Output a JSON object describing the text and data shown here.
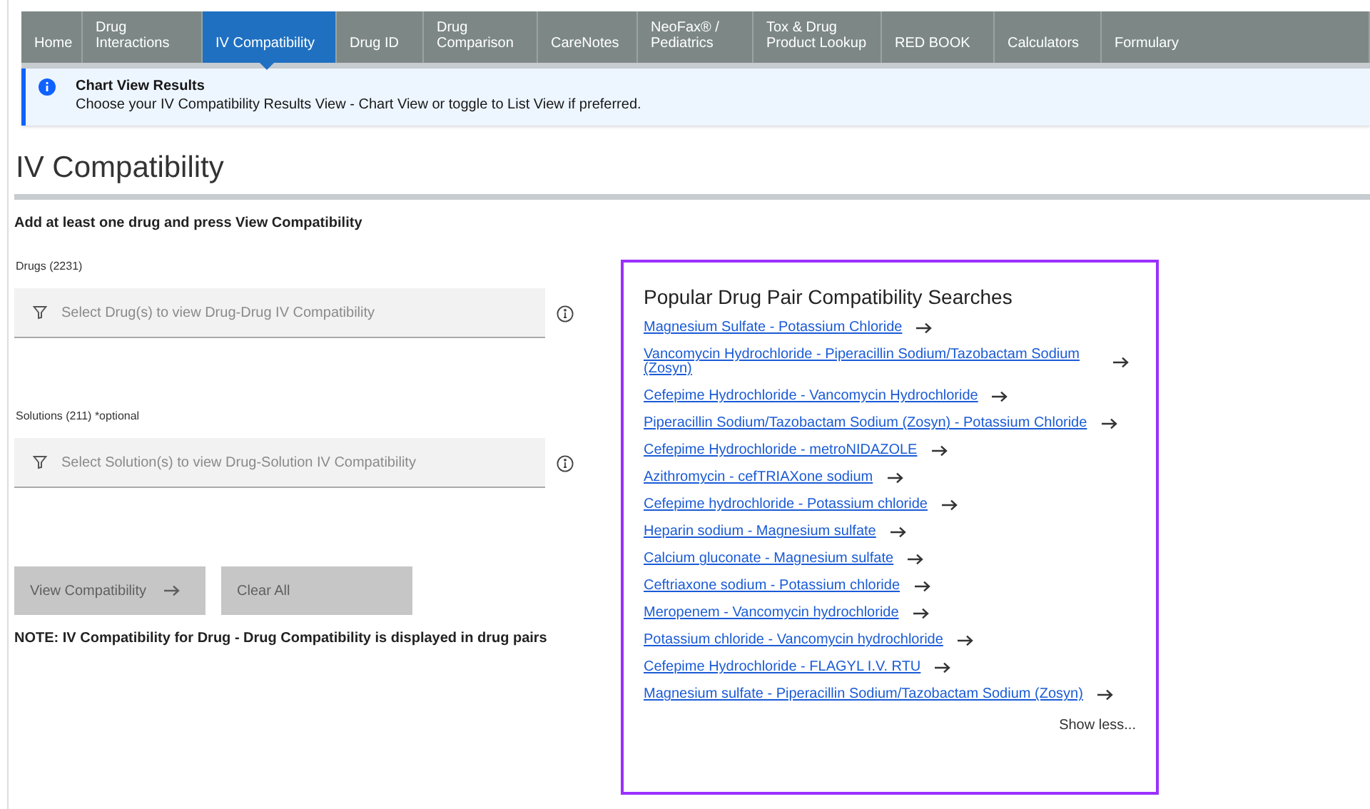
{
  "nav_tabs": [
    {
      "label": "Home",
      "selected": false
    },
    {
      "label": "Drug Interactions",
      "selected": false
    },
    {
      "label": "IV Compatibility",
      "selected": true
    },
    {
      "label": "Drug ID",
      "selected": false
    },
    {
      "label": "Drug Comparison",
      "selected": false
    },
    {
      "label": "CareNotes",
      "selected": false
    },
    {
      "label": "NeoFax® / Pediatrics",
      "selected": false
    },
    {
      "label": "Tox & Drug Product Lookup",
      "selected": false
    },
    {
      "label": "RED BOOK",
      "selected": false
    },
    {
      "label": "Calculators",
      "selected": false
    },
    {
      "label": "Formulary",
      "selected": false
    }
  ],
  "banner": {
    "title": "Chart View Results",
    "message": "Choose your IV Compatibility Results View - Chart View or toggle to List View if preferred."
  },
  "page_title": "IV Compatibility",
  "instruction": "Add at least one drug and press View Compatibility",
  "fields": [
    {
      "label": "Drugs (2231)",
      "placeholder": "Select Drug(s) to view Drug-Drug IV Compatibility"
    },
    {
      "label": "Solutions (211) *optional",
      "placeholder": "Select Solution(s) to view Drug-Solution IV Compatibility"
    }
  ],
  "buttons": [
    {
      "label": "View Compatibility",
      "disabled": true,
      "kind": "submit"
    },
    {
      "label": "Clear All",
      "disabled": true,
      "kind": "clear"
    }
  ],
  "note": "NOTE: IV Compatibility for Drug - Drug Compatibility is displayed in drug pairs",
  "popular": {
    "title": "Popular Drug Pair Compatibility Searches",
    "links": [
      "Magnesium Sulfate - Potassium Chloride",
      "Vancomycin Hydrochloride - Piperacillin Sodium/Tazobactam Sodium (Zosyn)",
      "Cefepime Hydrochloride - Vancomycin Hydrochloride",
      "Piperacillin Sodium/Tazobactam Sodium (Zosyn) - Potassium Chloride",
      "Cefepime Hydrochloride - metroNIDAZOLE",
      "Azithromycin - cefTRIAXone sodium",
      "Cefepime hydrochloride - Potassium chloride",
      "Heparin sodium - Magnesium sulfate",
      "Calcium gluconate - Magnesium sulfate",
      "Ceftriaxone sodium - Potassium chloride",
      "Meropenem - Vancomycin hydrochloride",
      "Potassium chloride - Vancomycin hydrochloride",
      "Cefepime Hydrochloride - FLAGYL I.V. RTU",
      "Magnesium sulfate - Piperacillin Sodium/Tazobactam Sodium (Zosyn)"
    ],
    "toggle": "Show less..."
  }
}
